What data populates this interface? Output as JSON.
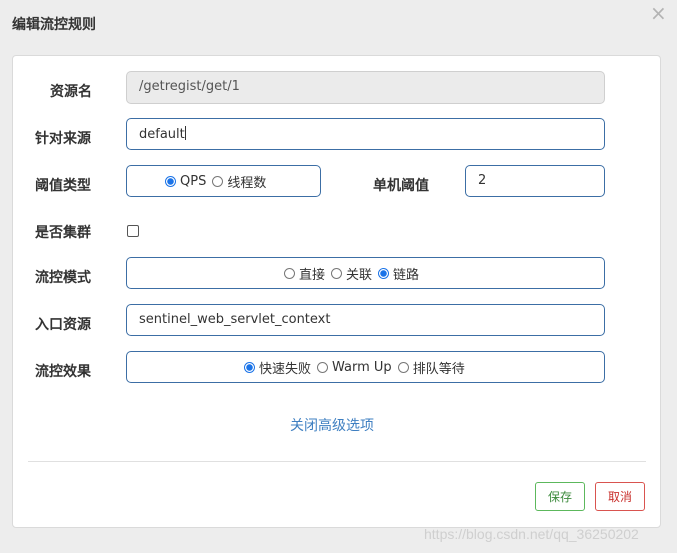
{
  "dialog": {
    "title": "编辑流控规则",
    "close_glyph": "×"
  },
  "form": {
    "resource": {
      "label": "资源名",
      "value": "/getregist/get/1"
    },
    "limit_app": {
      "label": "针对来源",
      "value": "default"
    },
    "threshold_type": {
      "label": "阈值类型",
      "options": [
        "QPS",
        "线程数"
      ],
      "selected": "QPS"
    },
    "single_threshold": {
      "label": "单机阈值",
      "value": "2"
    },
    "cluster": {
      "label": "是否集群",
      "checked": false
    },
    "strategy": {
      "label": "流控模式",
      "options": [
        "直接",
        "关联",
        "链路"
      ],
      "selected": "链路"
    },
    "ref_resource": {
      "label": "入口资源",
      "value": "sentinel_web_servlet_context"
    },
    "control_behavior": {
      "label": "流控效果",
      "options": [
        "快速失败",
        "Warm Up",
        "排队等待"
      ],
      "selected": "快速失败"
    },
    "advanced_toggle": "关闭高级选项"
  },
  "footer": {
    "save_label": "保存",
    "cancel_label": "取消"
  },
  "watermark": "https://blog.csdn.net/qq_36250202"
}
